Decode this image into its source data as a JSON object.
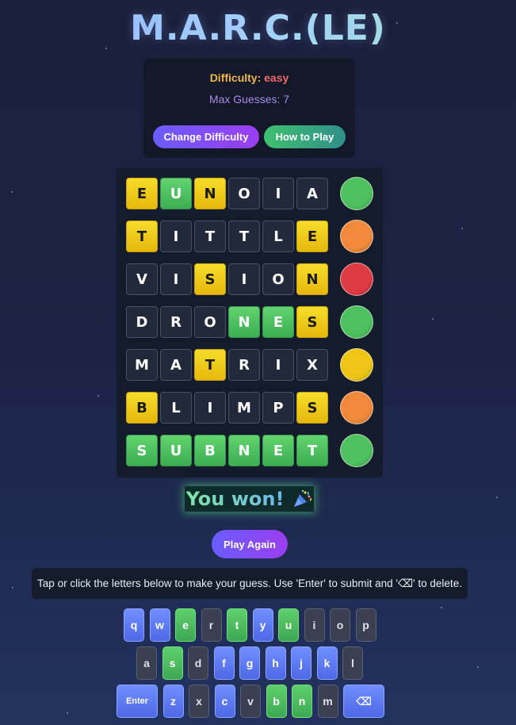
{
  "title": "M.A.R.C.(LE)",
  "settings": {
    "difficulty_label": "Difficulty:",
    "difficulty_value": "easy",
    "max_guesses": "Max Guesses: 7",
    "change_difficulty_label": "Change Difficulty",
    "how_to_play_label": "How to Play"
  },
  "colors": {
    "green": "#4cc15e",
    "yellow": "#eec514",
    "gray": "#22293a",
    "orange": "#f08a3a",
    "red": "#dd3a44",
    "accent": "#7b4ff5"
  },
  "board": [
    {
      "letters": [
        "E",
        "U",
        "N",
        "O",
        "I",
        "A"
      ],
      "states": [
        "yellow",
        "green",
        "yellow",
        "gray",
        "gray",
        "gray"
      ],
      "indicator": "green"
    },
    {
      "letters": [
        "T",
        "I",
        "T",
        "T",
        "L",
        "E"
      ],
      "states": [
        "yellow",
        "gray",
        "gray",
        "gray",
        "gray",
        "yellow"
      ],
      "indicator": "orange"
    },
    {
      "letters": [
        "V",
        "I",
        "S",
        "I",
        "O",
        "N"
      ],
      "states": [
        "gray",
        "gray",
        "yellow",
        "gray",
        "gray",
        "yellow"
      ],
      "indicator": "red"
    },
    {
      "letters": [
        "D",
        "R",
        "O",
        "N",
        "E",
        "S"
      ],
      "states": [
        "gray",
        "gray",
        "gray",
        "green",
        "green",
        "yellow"
      ],
      "indicator": "green"
    },
    {
      "letters": [
        "M",
        "A",
        "T",
        "R",
        "I",
        "X"
      ],
      "states": [
        "gray",
        "gray",
        "yellow",
        "gray",
        "gray",
        "gray"
      ],
      "indicator": "yellow"
    },
    {
      "letters": [
        "B",
        "L",
        "I",
        "M",
        "P",
        "S"
      ],
      "states": [
        "yellow",
        "gray",
        "gray",
        "gray",
        "gray",
        "yellow"
      ],
      "indicator": "orange"
    },
    {
      "letters": [
        "S",
        "U",
        "B",
        "N",
        "E",
        "T"
      ],
      "states": [
        "green",
        "green",
        "green",
        "green",
        "green",
        "green"
      ],
      "indicator": "green"
    }
  ],
  "result": {
    "message": "You won!",
    "icon": "party-popper-icon"
  },
  "play_again_label": "Play Again",
  "instructions": "Tap or click the letters below to make your guess. Use 'Enter' to submit and '⌫' to delete.",
  "keyboard": {
    "rows": [
      [
        {
          "label": "q",
          "state": "blue"
        },
        {
          "label": "w",
          "state": "blue"
        },
        {
          "label": "e",
          "state": "green"
        },
        {
          "label": "r",
          "state": "gray"
        },
        {
          "label": "t",
          "state": "green"
        },
        {
          "label": "y",
          "state": "blue"
        },
        {
          "label": "u",
          "state": "green"
        },
        {
          "label": "i",
          "state": "gray"
        },
        {
          "label": "o",
          "state": "gray"
        },
        {
          "label": "p",
          "state": "gray"
        }
      ],
      [
        {
          "label": "a",
          "state": "gray"
        },
        {
          "label": "s",
          "state": "green"
        },
        {
          "label": "d",
          "state": "gray"
        },
        {
          "label": "f",
          "state": "blue"
        },
        {
          "label": "g",
          "state": "blue"
        },
        {
          "label": "h",
          "state": "blue"
        },
        {
          "label": "j",
          "state": "blue"
        },
        {
          "label": "k",
          "state": "blue"
        },
        {
          "label": "l",
          "state": "gray"
        }
      ],
      [
        {
          "label": "Enter",
          "state": "blue"
        },
        {
          "label": "z",
          "state": "blue"
        },
        {
          "label": "x",
          "state": "gray"
        },
        {
          "label": "c",
          "state": "blue"
        },
        {
          "label": "v",
          "state": "gray"
        },
        {
          "label": "b",
          "state": "green"
        },
        {
          "label": "n",
          "state": "green"
        },
        {
          "label": "m",
          "state": "gray"
        },
        {
          "label": "⌫",
          "state": "blue"
        }
      ]
    ]
  }
}
